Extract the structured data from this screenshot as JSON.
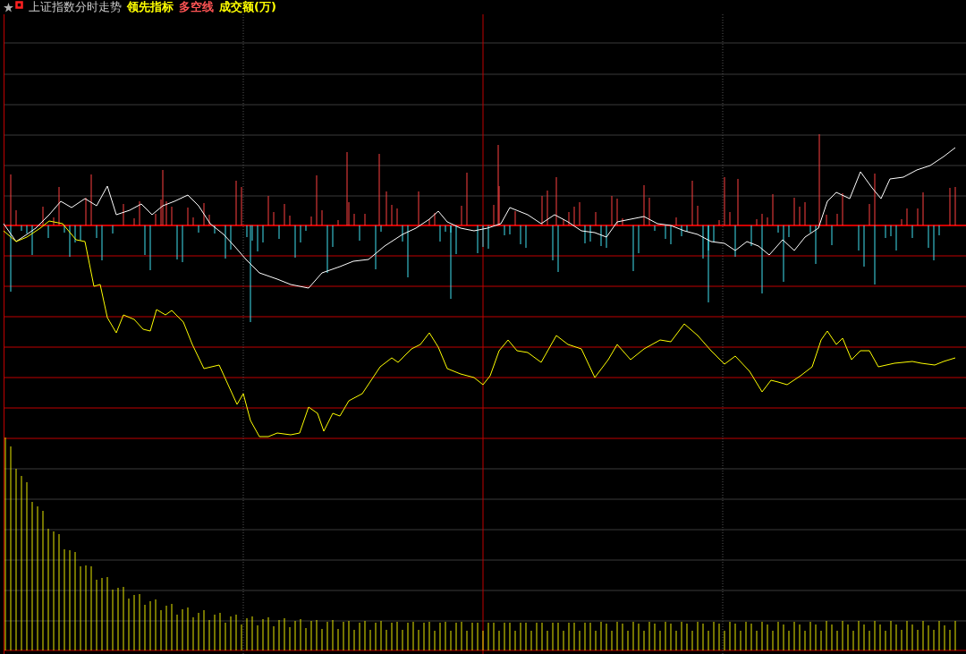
{
  "header": {
    "title": "上证指数分时走势",
    "indicators": [
      {
        "label": "领先指标",
        "color": "#ffff00"
      },
      {
        "label": "多空线",
        "color": "#ff5454"
      },
      {
        "label": "成交额(万)",
        "color": "#ffff00"
      }
    ]
  }
}
